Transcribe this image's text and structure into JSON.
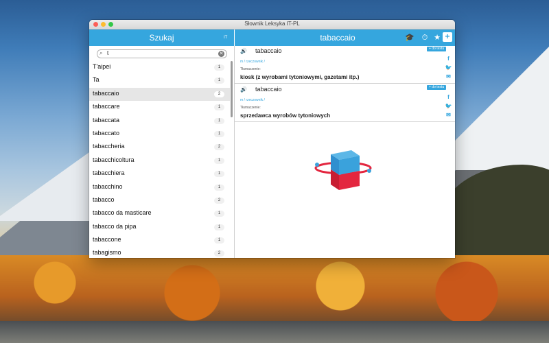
{
  "window": {
    "title": "Słownik Leksyka IT-PL"
  },
  "sidebar": {
    "header": "Szukaj",
    "lang_badge": "IT",
    "search": {
      "value": "t",
      "icon": "search-icon",
      "clear_icon": "clear-icon"
    },
    "items": [
      {
        "label": "T'aipei",
        "count": "1",
        "selected": false
      },
      {
        "label": "Ta",
        "count": "1",
        "selected": false
      },
      {
        "label": "tabaccaio",
        "count": "2",
        "selected": true
      },
      {
        "label": "tabaccare",
        "count": "1",
        "selected": false
      },
      {
        "label": "tabaccata",
        "count": "1",
        "selected": false
      },
      {
        "label": "tabaccato",
        "count": "1",
        "selected": false
      },
      {
        "label": "tabaccheria",
        "count": "2",
        "selected": false
      },
      {
        "label": "tabacchicoltura",
        "count": "1",
        "selected": false
      },
      {
        "label": "tabacchiera",
        "count": "1",
        "selected": false
      },
      {
        "label": "tabacchino",
        "count": "1",
        "selected": false
      },
      {
        "label": "tabacco",
        "count": "2",
        "selected": false
      },
      {
        "label": "tabacco da masticare",
        "count": "1",
        "selected": false
      },
      {
        "label": "tabacco da pipa",
        "count": "1",
        "selected": false
      },
      {
        "label": "tabaccone",
        "count": "1",
        "selected": false
      },
      {
        "label": "tabagismo",
        "count": "2",
        "selected": false
      }
    ]
  },
  "toolbar": {
    "title": "tabaccaio",
    "icons": [
      "graduation-cap-icon",
      "clock-icon",
      "star-icon",
      "plus-icon"
    ]
  },
  "entries": [
    {
      "word": "tabaccaio",
      "pos": "m / rzeczownik /",
      "label": "Tłumaczenie:",
      "translation": "kiosk (z wyrobami tytoniowymi, gazetami itp.)",
      "add_label": "+ do testu"
    },
    {
      "word": "tabaccaio",
      "pos": "m / rzeczownik /",
      "label": "Tłumaczenie:",
      "translation": "sprzedawca wyrobów tytoniowych",
      "add_label": "+ do testu"
    }
  ],
  "colors": {
    "accent": "#35a6de",
    "logo_red": "#e3263f",
    "logo_blue": "#2f8fcf"
  }
}
